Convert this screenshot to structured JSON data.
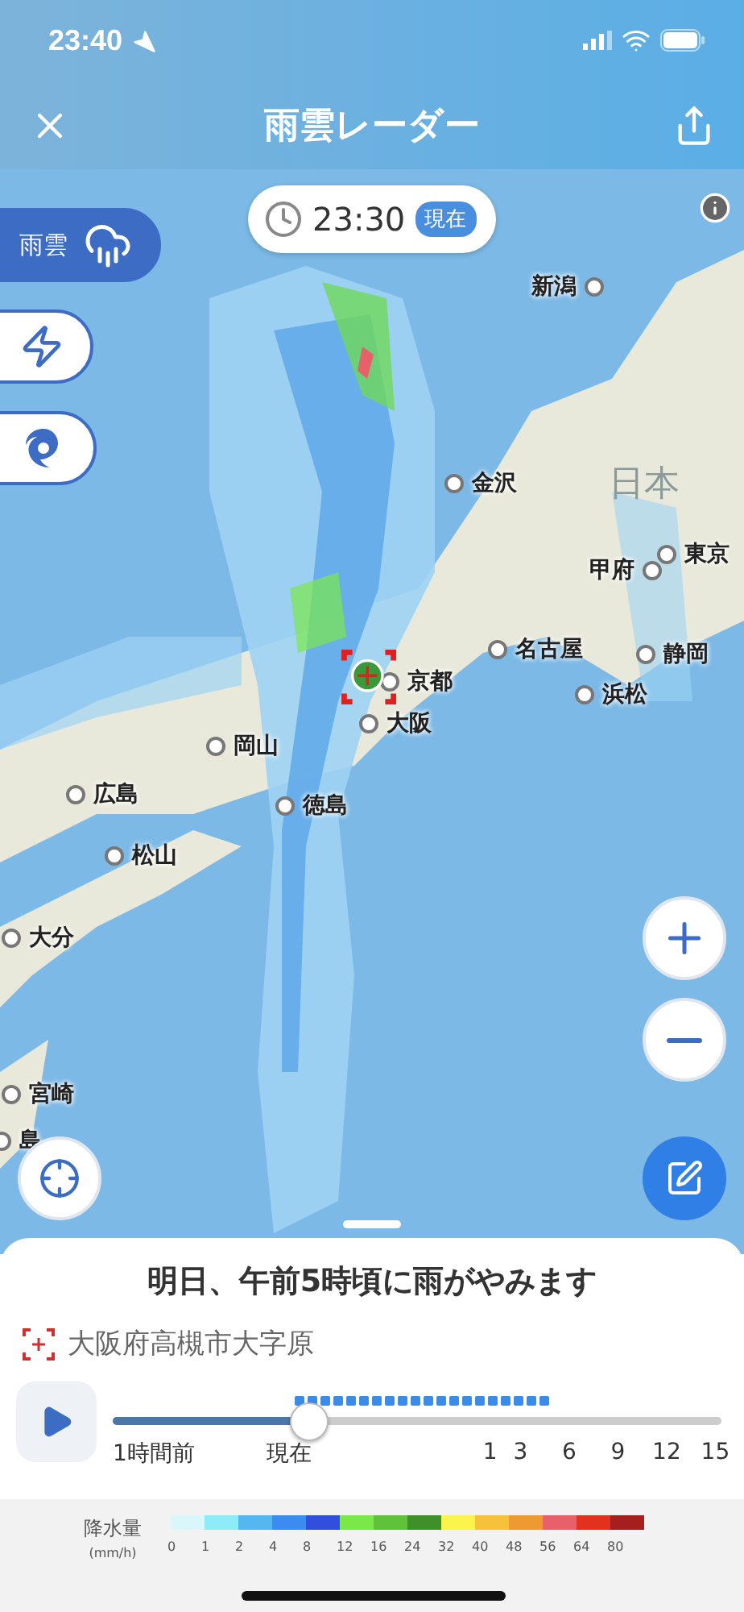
{
  "status_bar": {
    "time": "23:40"
  },
  "header": {
    "title": "雨雲レーダー"
  },
  "map": {
    "time": "23:30",
    "time_badge": "現在",
    "layers": [
      {
        "kind": "rain",
        "label": "雨雲",
        "selected": true
      },
      {
        "kind": "lightning",
        "selected": false
      },
      {
        "kind": "typhoon",
        "selected": false
      }
    ],
    "region_label": "日本",
    "cities": [
      {
        "name": "新潟"
      },
      {
        "name": "金沢"
      },
      {
        "name": "東京"
      },
      {
        "name": "甲府"
      },
      {
        "name": "名古屋"
      },
      {
        "name": "静岡"
      },
      {
        "name": "京都"
      },
      {
        "name": "浜松"
      },
      {
        "name": "大阪"
      },
      {
        "name": "岡山"
      },
      {
        "name": "広島"
      },
      {
        "name": "徳島"
      },
      {
        "name": "松山"
      },
      {
        "name": "大分"
      },
      {
        "name": "宮崎"
      },
      {
        "name": "島"
      }
    ]
  },
  "sheet": {
    "message": "明日、午前5時頃に雨がやみます",
    "location": "大阪府高槻市大字原",
    "timeline": {
      "level": 0.32,
      "labels": [
        "1時間前",
        "現在",
        "1",
        "3",
        "6",
        "9",
        "12",
        "15"
      ]
    }
  },
  "legend": {
    "title": "降水量",
    "unit": "(mm/h)",
    "items": [
      {
        "color": "#d9f7fb",
        "label": "0"
      },
      {
        "color": "#8eecf7",
        "label": "1"
      },
      {
        "color": "#54b7ef",
        "label": "2"
      },
      {
        "color": "#3a8cf0",
        "label": "4"
      },
      {
        "color": "#2f4fdc",
        "label": "8"
      },
      {
        "color": "#7be84a",
        "label": "12"
      },
      {
        "color": "#5fc23a",
        "label": "16"
      },
      {
        "color": "#3f8f2a",
        "label": "24"
      },
      {
        "color": "#fbf44a",
        "label": "32"
      },
      {
        "color": "#f5c23a",
        "label": "40"
      },
      {
        "color": "#ee9a30",
        "label": "48"
      },
      {
        "color": "#e8606a",
        "label": "56"
      },
      {
        "color": "#e2321f",
        "label": "64"
      },
      {
        "color": "#a51f1f",
        "label": "80"
      }
    ]
  }
}
